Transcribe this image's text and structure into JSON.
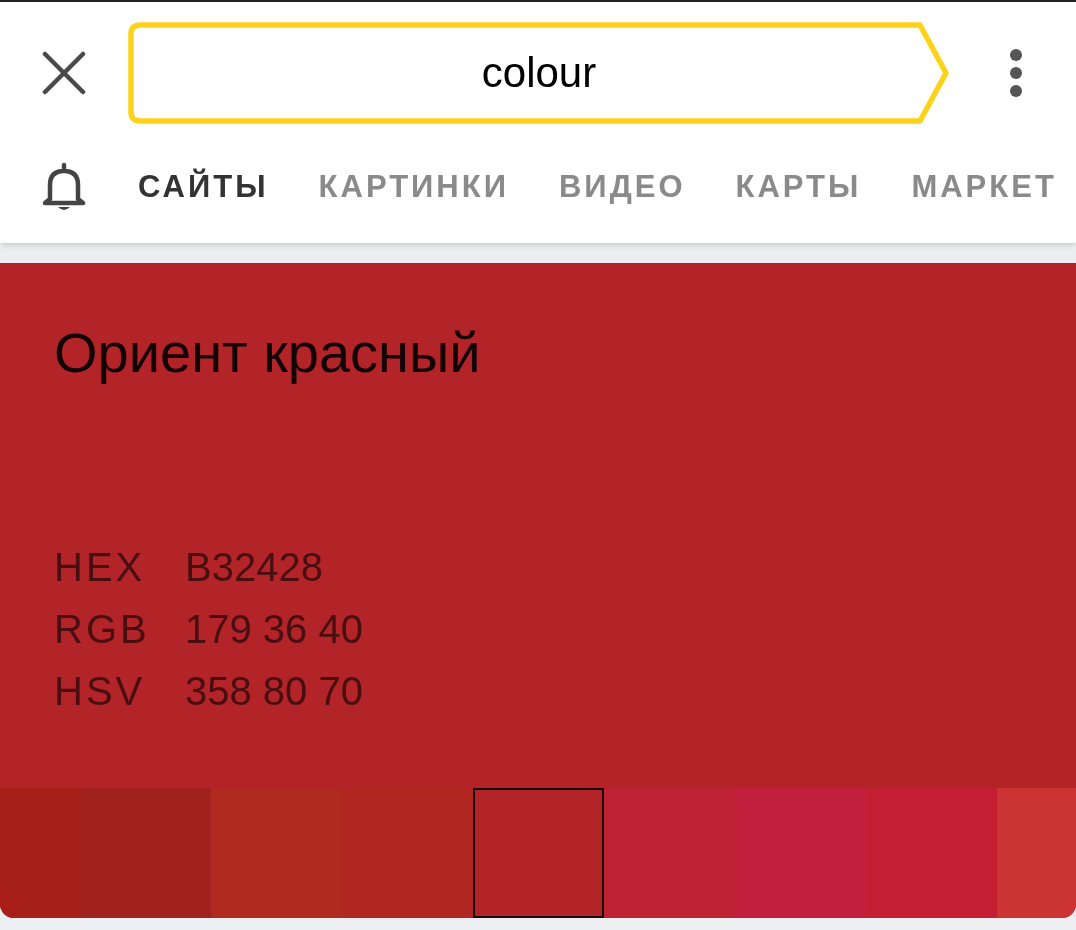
{
  "search": {
    "value": "colour"
  },
  "tabs": [
    {
      "label": "САЙТЫ",
      "selected": true
    },
    {
      "label": "КАРТИНКИ",
      "selected": false
    },
    {
      "label": "ВИДЕО",
      "selected": false
    },
    {
      "label": "КАРТЫ",
      "selected": false
    },
    {
      "label": "МАРКЕТ",
      "selected": false
    }
  ],
  "color_card": {
    "title": "Ориент красный",
    "codes": [
      {
        "label": "HEX",
        "value": "B32428"
      },
      {
        "label": "RGB",
        "value": "179 36 40"
      },
      {
        "label": "HSV",
        "value": "358 80 70"
      }
    ]
  },
  "swatches": [
    {
      "color": "#a81f1a",
      "selected": false
    },
    {
      "color": "#a1221d",
      "selected": false
    },
    {
      "color": "#b02a1f",
      "selected": false
    },
    {
      "color": "#b22621",
      "selected": false
    },
    {
      "color": "#b32428",
      "selected": true
    },
    {
      "color": "#be2232",
      "selected": false
    },
    {
      "color": "#c21f3c",
      "selected": false
    },
    {
      "color": "#c41e33",
      "selected": false
    },
    {
      "color": "#cc3333",
      "selected": false
    }
  ]
}
